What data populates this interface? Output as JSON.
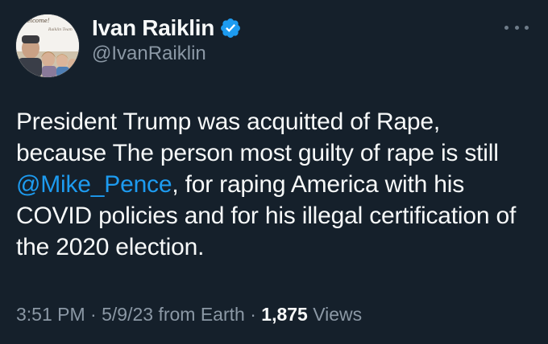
{
  "user": {
    "display_name": "Ivan Raiklin",
    "handle": "@IvanRaiklin",
    "avatar_banner_text": "Welcome!",
    "avatar_sign_text": "Raiklin Team"
  },
  "tweet": {
    "text_part1": "President Trump was acquitted of Rape, because The person most guilty of rape is still ",
    "mention": "@Mike_Pence",
    "text_part2": ", for raping America with his COVID policies and for his illegal certification of the 2020 election."
  },
  "meta": {
    "time": "3:51 PM",
    "separator1": " · ",
    "date": "5/9/23",
    "source": " from Earth",
    "separator2": " · ",
    "views_count": "1,875",
    "views_label": " Views"
  },
  "colors": {
    "background": "#15202b",
    "text": "#f7f9f9",
    "secondary": "#8b98a5",
    "accent": "#1d9bf0"
  },
  "icons": {
    "verified": "verified-badge-icon",
    "more": "more-options-icon"
  }
}
